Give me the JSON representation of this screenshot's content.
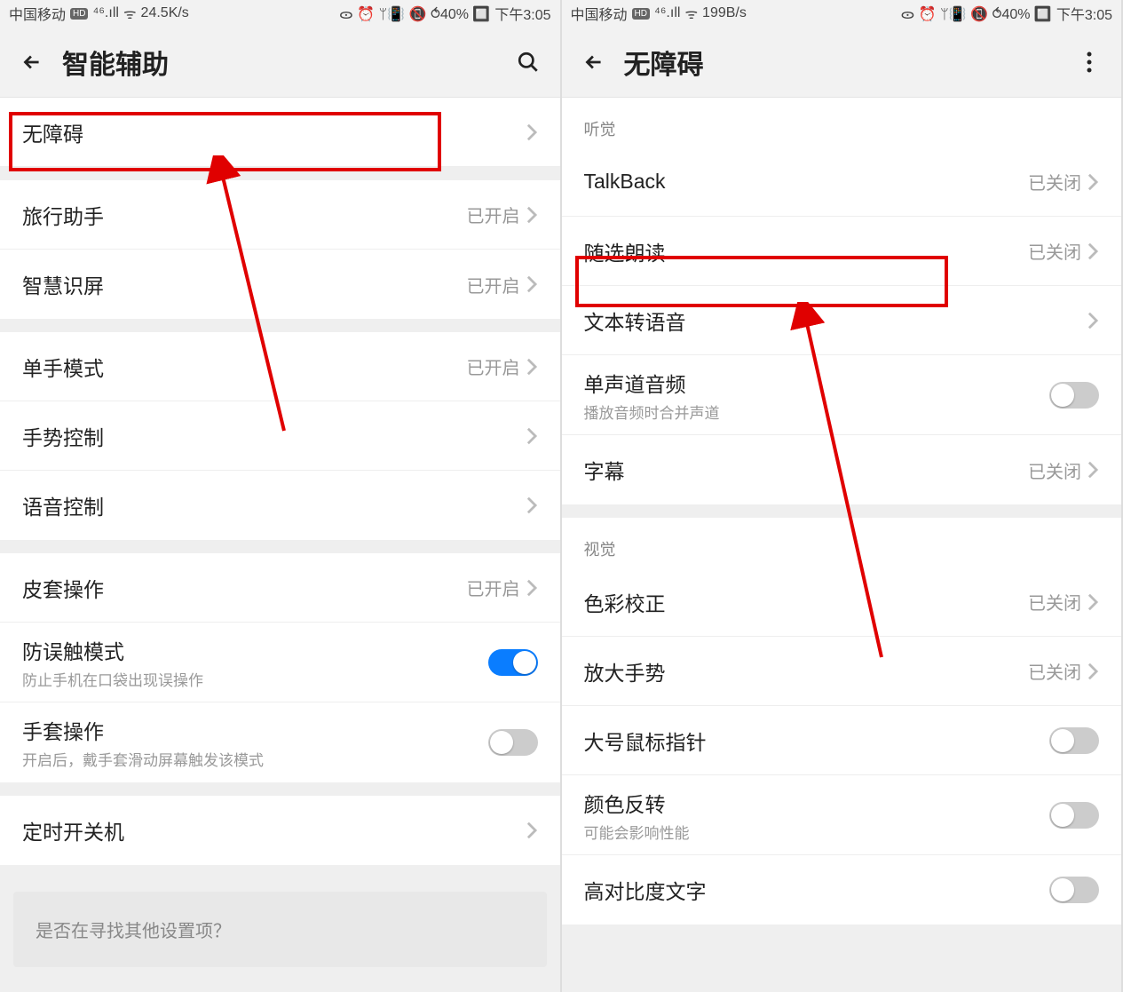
{
  "left": {
    "statusbar": {
      "carrier": "中国移动",
      "hd": "HD",
      "net": "⁴⁶.ıll",
      "wifi": "ᯤ",
      "speed": "24.5K/s",
      "icons_right": "ᯣ ⏰ ᛘ📳 📵 ⥀40% 🔲",
      "time": "下午3:05"
    },
    "header": {
      "title": "智能辅助"
    },
    "rows": {
      "accessibility": "无障碍",
      "travel": {
        "label": "旅行助手",
        "value": "已开启"
      },
      "smart": {
        "label": "智慧识屏",
        "value": "已开启"
      },
      "onehand": {
        "label": "单手模式",
        "value": "已开启"
      },
      "gesture": "手势控制",
      "voice": "语音控制",
      "cover": {
        "label": "皮套操作",
        "value": "已开启"
      },
      "mistouch": {
        "label": "防误触模式",
        "sub": "防止手机在口袋出现误操作"
      },
      "glove": {
        "label": "手套操作",
        "sub": "开启后，戴手套滑动屏幕触发该模式"
      },
      "timer": "定时开关机"
    },
    "footer_prompt": "是否在寻找其他设置项？"
  },
  "right": {
    "statusbar": {
      "carrier": "中国移动",
      "hd": "HD",
      "net": "⁴⁶.ıll",
      "wifi": "ᯤ",
      "speed": "199B/s",
      "icons_right": "ᯣ ⏰ ᛘ📳 📵 ⥀40% 🔲",
      "time": "下午3:05"
    },
    "header": {
      "title": "无障碍"
    },
    "section1": "听觉",
    "rows1": {
      "talkback": {
        "label": "TalkBack",
        "value": "已关闭"
      },
      "select_read": {
        "label": "随选朗读",
        "value": "已关闭"
      },
      "tts": "文本转语音",
      "mono": {
        "label": "单声道音频",
        "sub": "播放音频时合并声道"
      },
      "caption": {
        "label": "字幕",
        "value": "已关闭"
      }
    },
    "section2": "视觉",
    "rows2": {
      "color_cor": {
        "label": "色彩校正",
        "value": "已关闭"
      },
      "magnify": {
        "label": "放大手势",
        "value": "已关闭"
      },
      "pointer": "大号鼠标指针",
      "inversion": {
        "label": "颜色反转",
        "sub": "可能会影响性能"
      },
      "highcontrast": "高对比度文字"
    }
  }
}
